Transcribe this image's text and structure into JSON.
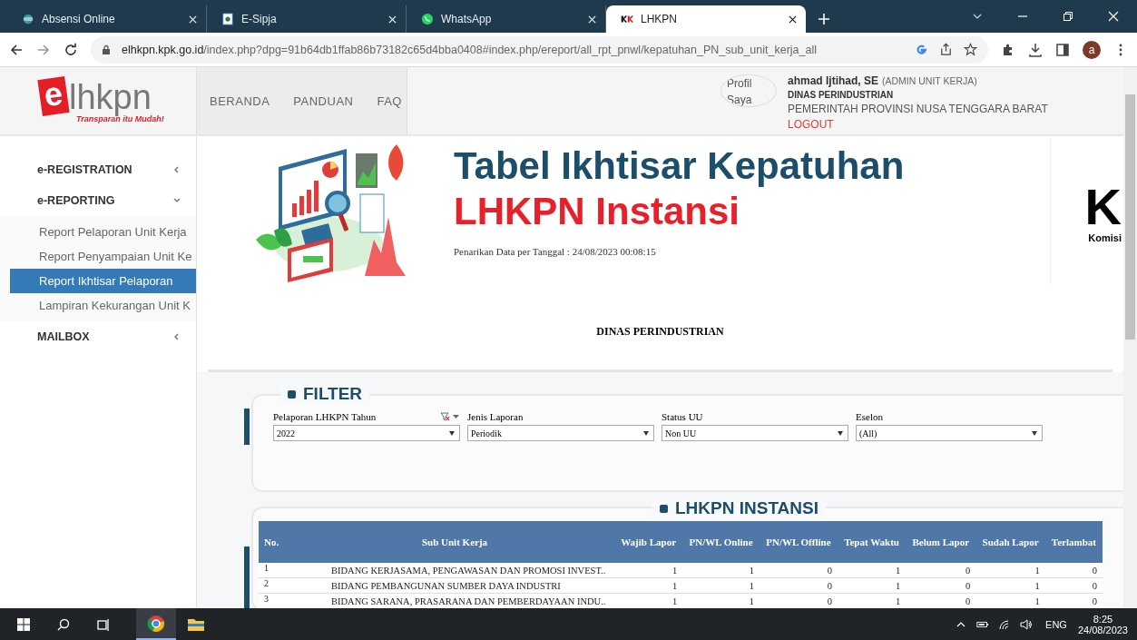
{
  "browser": {
    "tabs": [
      {
        "title": "Absensi Online",
        "selected": false
      },
      {
        "title": "E-Sipja",
        "selected": false
      },
      {
        "title": "WhatsApp",
        "selected": false
      },
      {
        "title": "LHKPN",
        "selected": true
      }
    ],
    "url_domain": "elhkpn.kpk.go.id",
    "url_path": "/index.php?dpg=91b64db1ffab86b73182c65d4bba0408#index.php/ereport/all_rpt_pnwl/kepatuhan_PN_sub_unit_kerja_all",
    "avatar_letter": "a"
  },
  "header": {
    "logo": {
      "mark": "e",
      "name": "lhkpn",
      "tagline": "Transparan itu Mudah!"
    },
    "nav": [
      "BERANDA",
      "PANDUAN",
      "FAQ"
    ],
    "user": {
      "avatar_alt": "Profil Saya",
      "name": "ahmad Ijtihad, SE",
      "role": "(ADMIN UNIT KERJA)",
      "unit": "DINAS PERINDUSTRIAN",
      "province": "PEMERINTAH PROVINSI NUSA TENGGARA BARAT",
      "logout": "LOGOUT"
    }
  },
  "sidebar": [
    {
      "label": "e-REGISTRATION",
      "expanded": false
    },
    {
      "label": "e-REPORTING",
      "expanded": true,
      "children": [
        {
          "label": "Report Pelaporan Unit Kerja",
          "selected": false
        },
        {
          "label": "Report Penyampaian Unit Ke",
          "selected": false
        },
        {
          "label": "Report Ikhtisar Pelaporan",
          "selected": true
        },
        {
          "label": "Lampiran Kekurangan Unit K",
          "selected": false
        }
      ]
    },
    {
      "label": "MAILBOX",
      "expanded": false
    }
  ],
  "report": {
    "title_line1": "Tabel Ikhtisar Kepatuhan",
    "title_line2": "LHKPN Instansi",
    "timestamp": "Penarikan Data per Tanggal : 24/08/2023 00:08:15",
    "kpk_logo_letter": "K",
    "kpk_caption": "Komisi",
    "unit": "DINAS PERINDUSTRIAN"
  },
  "filter": {
    "title": "FILTER",
    "fields": [
      {
        "label": "Pelaporan LHKPN Tahun",
        "value": "2022",
        "clear_icon": true
      },
      {
        "label": "Jenis Laporan",
        "value": "Periodik",
        "clear_icon": false
      },
      {
        "label": "Status UU",
        "value": "Non UU",
        "clear_icon": false
      },
      {
        "label": "Eselon",
        "value": "(All)",
        "clear_icon": false
      }
    ]
  },
  "table": {
    "title": "LHKPN INSTANSI",
    "columns": [
      "No.",
      "Sub Unit Kerja",
      "Wajib Lapor",
      "PN/WL Online",
      "PN/WL Offline",
      "Tepat Waktu",
      "Belum Lapor",
      "Sudah Lapor",
      "Terlambat"
    ],
    "rows": [
      {
        "no": "1",
        "name": "BIDANG KERJASAMA, PENGAWASAN DAN PROMOSI INVEST..",
        "values": [
          "1",
          "1",
          "0",
          "1",
          "0",
          "1",
          "0"
        ]
      },
      {
        "no": "2",
        "name": "BIDANG PEMBANGUNAN SUMBER DAYA INDUSTRI",
        "values": [
          "1",
          "1",
          "0",
          "1",
          "0",
          "1",
          "0"
        ]
      },
      {
        "no": "3",
        "name": "BIDANG SARANA, PRASARANA DAN PEMBERDAYAAN INDU..",
        "values": [
          "1",
          "1",
          "0",
          "1",
          "0",
          "1",
          "0"
        ]
      }
    ]
  },
  "taskbar": {
    "apps": [
      {
        "kind": "browser",
        "active": true
      },
      {
        "kind": "folder",
        "active": false
      }
    ],
    "language": "ENG",
    "time": "8:25",
    "date": "24/08/2023"
  }
}
